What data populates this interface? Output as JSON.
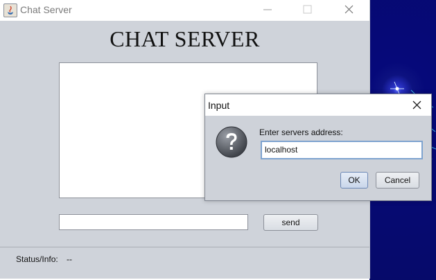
{
  "window": {
    "title": "Chat Server",
    "heading": "CHAT SERVER"
  },
  "main": {
    "message_input": {
      "value": ""
    },
    "send_label": "send",
    "status_label": "Status/Info:",
    "status_value": "--"
  },
  "dialog": {
    "title": "Input",
    "prompt": "Enter servers address:",
    "address_value": "localhost",
    "ok_label": "OK",
    "cancel_label": "Cancel"
  },
  "icons": [
    "java-app-icon",
    "minimize-icon",
    "maximize-icon",
    "close-icon",
    "question-icon"
  ],
  "colors": {
    "window_bg": "#cfd3da",
    "focus_border": "#7ea3cf",
    "wallpaper": "#06097a"
  }
}
